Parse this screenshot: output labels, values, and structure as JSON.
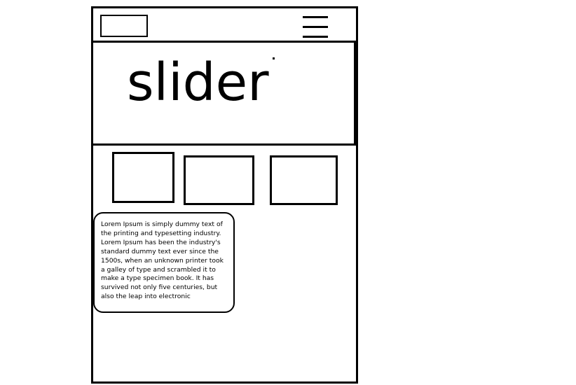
{
  "slider": {
    "label": "slider"
  },
  "content": {
    "paragraph": "Lorem Ipsum is simply dummy text of the printing and typesetting industry. Lorem Ipsum has been the industry's standard dummy text ever since the 1500s, when an unknown printer took a galley of type and scrambled it to make a type specimen book. It has survived not only five centuries, but also the leap into electronic"
  },
  "icons": {
    "menu": "hamburger-menu-icon"
  }
}
